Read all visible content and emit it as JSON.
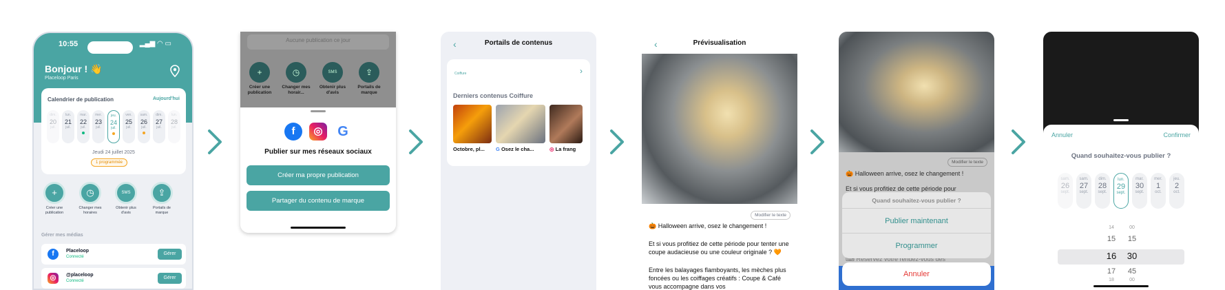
{
  "colors": {
    "accent": "#4aa5a3",
    "danger": "#e53935",
    "orange": "#f5a623"
  },
  "screen1": {
    "time": "10:55",
    "status_icons": "▂▄▆ ◠ ▭",
    "greeting": "Bonjour ! 👋",
    "business": "Placeloop Paris",
    "calendar": {
      "title": "Calendrier de publication",
      "today_link": "Aujourd'hui",
      "days": [
        {
          "wd": "dim.",
          "n": "20",
          "m": "juil."
        },
        {
          "wd": "lun.",
          "n": "21",
          "m": "juil."
        },
        {
          "wd": "mar.",
          "n": "22",
          "m": "juil."
        },
        {
          "wd": "mer.",
          "n": "23",
          "m": "juil."
        },
        {
          "wd": "jeu.",
          "n": "24",
          "m": "juil."
        },
        {
          "wd": "ven.",
          "n": "25",
          "m": "juil."
        },
        {
          "wd": "sam.",
          "n": "26",
          "m": "juil."
        },
        {
          "wd": "dim.",
          "n": "27",
          "m": "juil."
        },
        {
          "wd": "lun.",
          "n": "28",
          "m": "juil."
        }
      ],
      "selected_date": "Jeudi 24 juillet 2025",
      "badge": "1 programmée"
    },
    "actions": [
      {
        "icon": "+",
        "label": "Créer une publication"
      },
      {
        "icon": "◷",
        "label": "Changer mes horaires"
      },
      {
        "icon": "SMS",
        "label": "Obtenir plus d'avis"
      },
      {
        "icon": "⇪",
        "label": "Portails de marque"
      }
    ],
    "media_title": "Gérer mes médias",
    "media": [
      {
        "name": "Placeloop",
        "status": "Connecté",
        "button": "Gérer",
        "icon": "f"
      },
      {
        "name": "@placeloop",
        "status": "Connecté",
        "button": "Gérer",
        "icon": "◎"
      }
    ]
  },
  "screen2": {
    "no_pub": "Aucune publication ce jour",
    "actions": [
      {
        "icon": "+",
        "label": "Créer une publication"
      },
      {
        "icon": "◷",
        "label": "Changer mes horair..."
      },
      {
        "icon": "SMS",
        "label": "Obtenir plus d'avis"
      },
      {
        "icon": "⇪",
        "label": "Portails de marque"
      }
    ],
    "social_icons": {
      "facebook": "f",
      "instagram": "◎",
      "google": "G"
    },
    "title": "Publier sur mes réseaux sociaux",
    "btn_own": "Créer ma propre publication",
    "btn_brand": "Partager du contenu de marque"
  },
  "screen3": {
    "back": "‹",
    "title": "Portails de contenus",
    "logo": "Coiffure",
    "chevron": "›",
    "subtitle": "Derniers contenus Coiffure",
    "items": [
      {
        "label": "Octobre, pl..."
      },
      {
        "label": "Osez le cha..."
      },
      {
        "label": "La frang"
      }
    ]
  },
  "screen4": {
    "back": "‹",
    "title": "Prévisualisation",
    "edit": "Modifier le texte",
    "text_lines": [
      "🎃 Halloween arrive, osez le changement !",
      "",
      "Et si vous profitiez de cette période pour tenter une coupe audacieuse ou une couleur originale ? 🧡",
      "Entre les balayages flamboyants, les mèches plus foncées ou les coiffages créatifs : Coupe & Café  vous accompagne dans vos"
    ]
  },
  "screen5": {
    "edit": "Modifier le texte",
    "text1": "🎃 Halloween arrive, osez le changement !",
    "text2": "Et si vous profitiez de cette période pour",
    "text3": "⌨ Réservez votre rendez-vous dès",
    "sheet_title": "Quand souhaitez-vous publier ?",
    "now": "Publier maintenant",
    "schedule": "Programmer",
    "cancel": "Annuler"
  },
  "screen6": {
    "cancel": "Annuler",
    "confirm": "Confirmer",
    "question": "Quand souhaitez-vous publier ?",
    "days": [
      {
        "wd": "sam.",
        "n": "26",
        "m": "sept."
      },
      {
        "wd": "sam.",
        "n": "27",
        "m": "sept."
      },
      {
        "wd": "dim.",
        "n": "28",
        "m": "sept."
      },
      {
        "wd": "lun.",
        "n": "29",
        "m": "sept."
      },
      {
        "wd": "mar.",
        "n": "30",
        "m": "sept."
      },
      {
        "wd": "mer.",
        "n": "1",
        "m": "oct."
      },
      {
        "wd": "jeu.",
        "n": "2",
        "m": "oct."
      }
    ],
    "hours": [
      "14",
      "15",
      "16",
      "17",
      "18"
    ],
    "minutes": [
      "00",
      "15",
      "30",
      "45",
      "00"
    ]
  }
}
